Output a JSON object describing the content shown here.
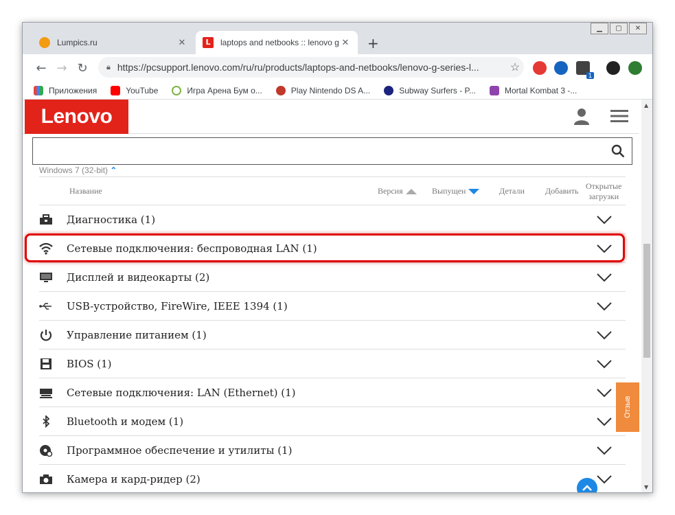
{
  "browser": {
    "tabs": [
      {
        "title": "Lumpics.ru",
        "active": false,
        "favicon_color": "#f39c12"
      },
      {
        "title": "laptops and netbooks :: lenovo g",
        "active": true,
        "favicon_color": "#e2231a",
        "favicon_letter": "L"
      }
    ],
    "address": "https://pcsupport.lenovo.com/ru/ru/products/laptops-and-netbooks/lenovo-g-series-l...",
    "ext_badge": "1",
    "bookmarks": [
      {
        "label": "Приложения",
        "icon": "apps-grid-icon",
        "color": "#e8453c"
      },
      {
        "label": "YouTube",
        "icon": "youtube-icon",
        "color": "#ff0000"
      },
      {
        "label": "Игра Арена Бум о...",
        "icon": "g-icon",
        "color": "#7cb342"
      },
      {
        "label": "Play Nintendo DS A...",
        "icon": "gamepad-icon",
        "color": "#c0392b"
      },
      {
        "label": "Subway Surfers - P...",
        "icon": "subway-icon",
        "color": "#1a237e"
      },
      {
        "label": "Mortal Kombat 3 -...",
        "icon": "mk-icon",
        "color": "#8e44ad"
      }
    ]
  },
  "site": {
    "logo": "Lenovo",
    "os_line": "Windows 7 (32-bit)",
    "columns": {
      "name": "Название",
      "version": "Версия",
      "released": "Выпущен",
      "details": "Детали",
      "add": "Добавить",
      "open_line1": "Открытые",
      "open_line2": "загрузки"
    },
    "categories": [
      {
        "label": "Диагностика (1)",
        "icon": "toolbox-icon"
      },
      {
        "label": "Сетевые подключения: беспроводная LAN (1)",
        "icon": "wifi-icon"
      },
      {
        "label": "Дисплей и видеокарты (2)",
        "icon": "monitor-icon"
      },
      {
        "label": "USB-устройство, FireWire, IEEE 1394 (1)",
        "icon": "usb-icon"
      },
      {
        "label": "Управление питанием (1)",
        "icon": "power-icon"
      },
      {
        "label": "BIOS (1)",
        "icon": "floppy-icon"
      },
      {
        "label": "Сетевые подключения: LAN (Ethernet) (1)",
        "icon": "ethernet-icon"
      },
      {
        "label": "Bluetooth и модем (1)",
        "icon": "bluetooth-icon"
      },
      {
        "label": "Программное обеспечение и утилиты (1)",
        "icon": "software-disc-icon"
      },
      {
        "label": "Камера и кард-ридер (2)",
        "icon": "camera-icon"
      }
    ],
    "feedback": "Отзыв"
  }
}
